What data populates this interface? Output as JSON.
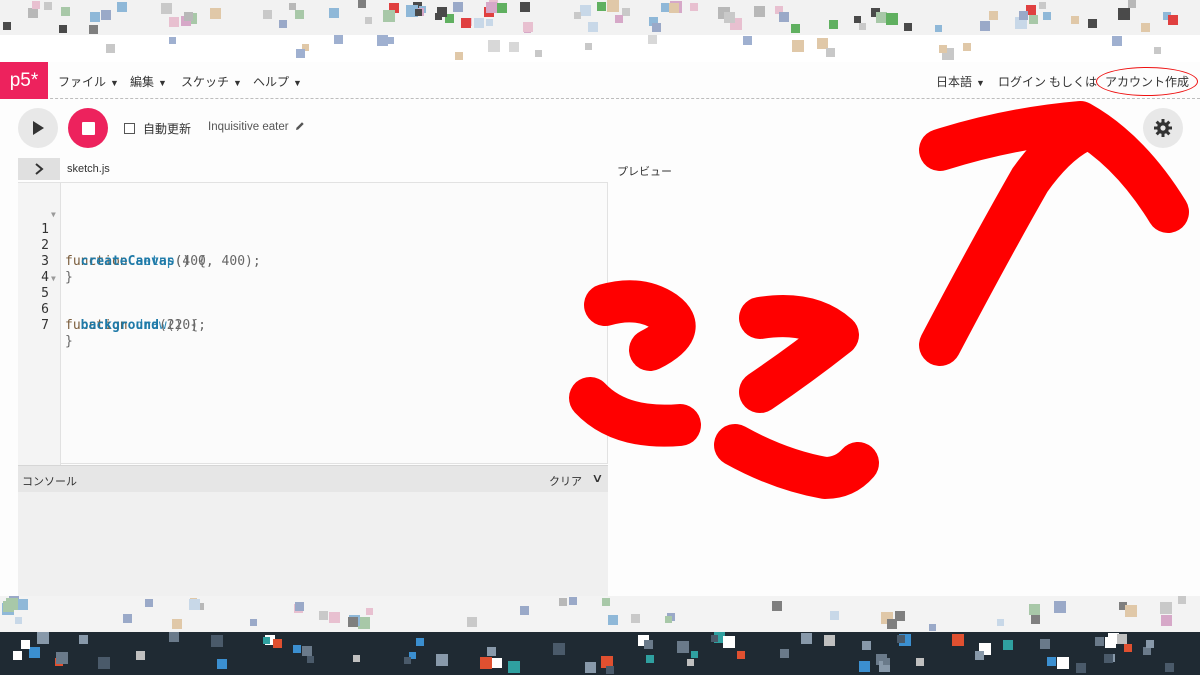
{
  "nav": {
    "logo": "p5*",
    "menus": [
      {
        "label": "ファイル"
      },
      {
        "label": "編集"
      },
      {
        "label": "スケッチ"
      },
      {
        "label": "ヘルプ"
      }
    ],
    "language": "日本語",
    "login": "ログイン",
    "or": "もしくは",
    "create_account": "アカウント作成"
  },
  "toolbar": {
    "autorefresh_label": "自動更新",
    "autorefresh_checked": false,
    "sketch_name": "Inquisitive eater"
  },
  "editor": {
    "filename": "sketch.js",
    "lines": [
      {
        "num": "1",
        "text": "function setup() {"
      },
      {
        "num": "2",
        "text": "  createCanvas(400, 400);"
      },
      {
        "num": "3",
        "text": "}"
      },
      {
        "num": "4",
        "text": ""
      },
      {
        "num": "5",
        "text": "function draw() {"
      },
      {
        "num": "6",
        "text": "  background(220);"
      },
      {
        "num": "7",
        "text": "}"
      }
    ]
  },
  "console": {
    "title": "コンソール",
    "clear": "クリア"
  },
  "preview": {
    "label": "プレビュー"
  },
  "annotation": {
    "text": "ここ",
    "color": "#ff0000"
  },
  "colors": {
    "brand": "#ed225d",
    "annotation": "#ff0000"
  }
}
